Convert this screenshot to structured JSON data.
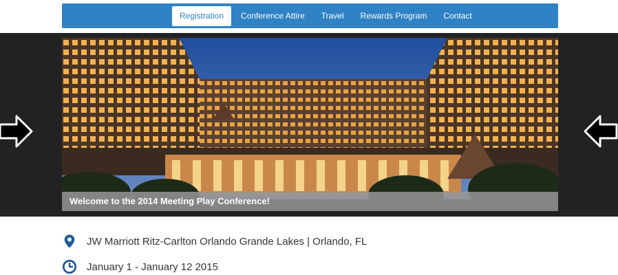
{
  "nav": {
    "items": [
      {
        "label": "Registration",
        "active": true
      },
      {
        "label": "Conference Attire"
      },
      {
        "label": "Travel"
      },
      {
        "label": "Rewards Program"
      },
      {
        "label": "Contact"
      }
    ],
    "color": "#2f82c4"
  },
  "hero": {
    "caption": "Welcome to the 2014 Meeting Play Conference!",
    "prev_icon": "arrow-left-icon",
    "next_icon": "arrow-left-icon"
  },
  "info": {
    "location": "JW Marriott Ritz-Carlton Orlando Grande Lakes | Orlando, FL",
    "dates": "January 1 - January 12 2015",
    "location_icon": "map-pin-icon",
    "date_icon": "clock-icon",
    "icon_color": "#1d5a96"
  }
}
